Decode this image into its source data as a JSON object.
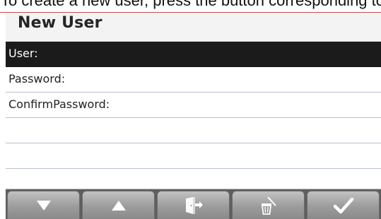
{
  "caption": {
    "text": "To create a new user, press the button corresponding to the"
  },
  "screen": {
    "title": "New User",
    "fields": [
      {
        "label": "User:",
        "selected": true
      },
      {
        "label": "Password:",
        "selected": false
      },
      {
        "label": "ConfirmPassword:",
        "selected": false
      },
      {
        "label": "",
        "selected": false
      },
      {
        "label": "",
        "selected": false
      },
      {
        "label": "",
        "selected": false
      }
    ]
  },
  "softkeys": [
    {
      "icon": "down-arrow-icon"
    },
    {
      "icon": "up-arrow-icon"
    },
    {
      "icon": "exit-door-icon"
    },
    {
      "icon": "trash-icon"
    },
    {
      "icon": "checkmark-icon"
    }
  ],
  "colors": {
    "selected_row": "#1b1b1b",
    "softkey_bar": "#5e5e5e",
    "divider": "#b9c2cc"
  }
}
